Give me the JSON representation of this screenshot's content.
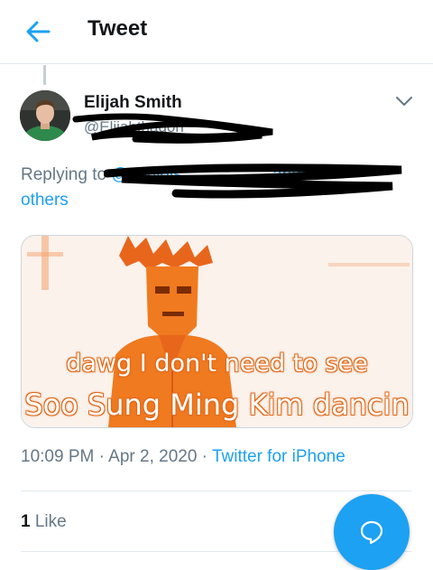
{
  "header": {
    "title": "Tweet",
    "back_icon": "arrow-left-icon"
  },
  "tweet": {
    "author": {
      "display_name": "Elijah Smith",
      "handle": "@Elijahthadon"
    },
    "more_icon": "chevron-down-icon",
    "replying": {
      "prefix": "Replying to ",
      "mentions": "@seulgis_________ and 3",
      "suffix": "others"
    },
    "media": {
      "caption_line1": "dawg I don't need to see",
      "caption_line2": "Soo Sung Ming Kim dancin"
    },
    "timestamp": "10:09 PM · Apr 2, 2020 · ",
    "source": "Twitter for iPhone",
    "likes": {
      "count": "1",
      "label": " Like"
    }
  },
  "fab": {
    "icon": "reply-bubble-icon"
  },
  "colors": {
    "accent": "#1da1f2",
    "secondary_text": "#657786",
    "primary_text": "#14171a",
    "meme_orange": "#f07a1f"
  }
}
